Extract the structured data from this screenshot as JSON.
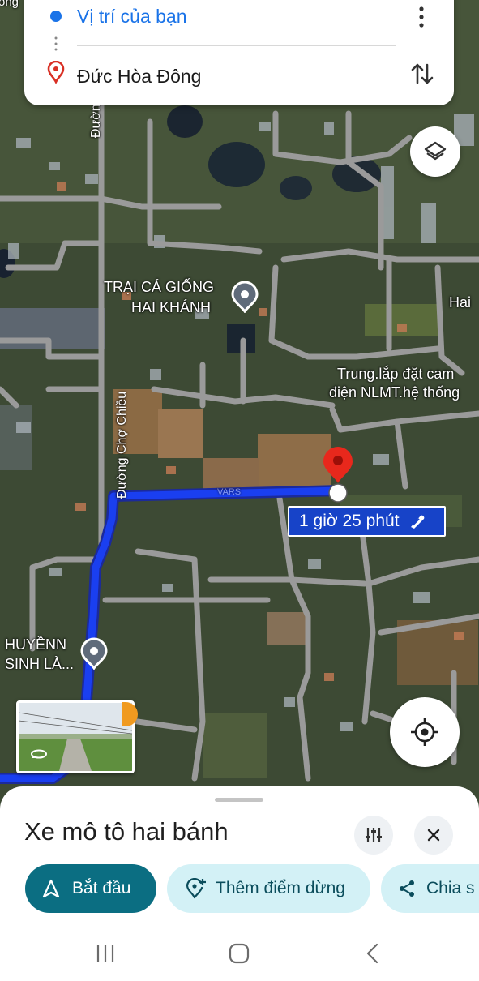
{
  "directions": {
    "origin": "Vị trí của bạn",
    "destination": "Đức Hòa Đông"
  },
  "map": {
    "labels": {
      "top_road": "Đường",
      "road_vertical": "Đường Chợ Chiều",
      "fish_farm_1": "TRẠI CÁ GIỐNG",
      "fish_farm_2": "HAI KHÁNH",
      "hai": "Hai",
      "trung_1": "Trung.lắp đặt cam",
      "trung_2": "điện NLMT.hệ thống",
      "huyen_1": "HUYỀNN",
      "huyen_2": "SINH LÀ...",
      "partial_top": "ông"
    },
    "route_time": "1 giờ 25 phút",
    "watermark": "VARS",
    "route_color": "#1a3ff0"
  },
  "sheet": {
    "mode": "Xe mô tô hai bánh",
    "start_label": "Bắt đầu",
    "add_stop_label": "Thêm điểm dừng",
    "share_label": "Chia s"
  }
}
